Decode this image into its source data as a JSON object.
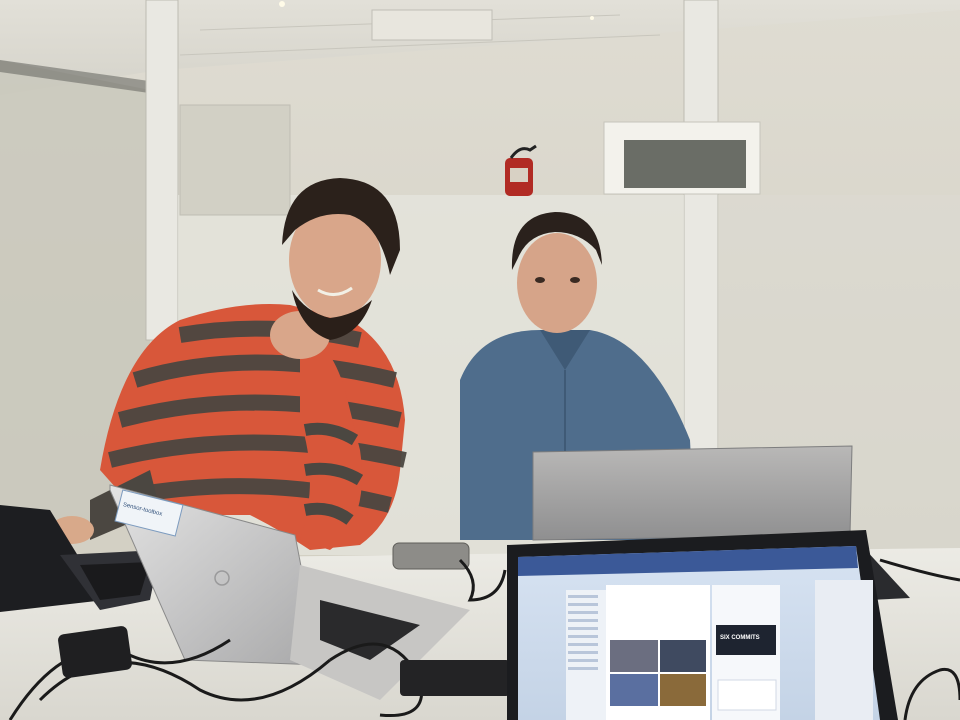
{
  "scene": {
    "description_colors": {
      "wall": "#d8d5c6",
      "ceiling": "#e6e4dc",
      "table": "#e9e6dd",
      "sweater_orange": "#d8573a",
      "sweater_gray": "#4a4640",
      "shirt_blue": "#4f6d8c",
      "laptop_silver": "#c9c8c6",
      "laptop_black": "#1c1d20",
      "screen_blue": "#3b5998"
    }
  },
  "laptop_sticker": {
    "text": "Sensor-toolbox"
  },
  "screen": {
    "promo_text": "SIX COMMITS"
  }
}
